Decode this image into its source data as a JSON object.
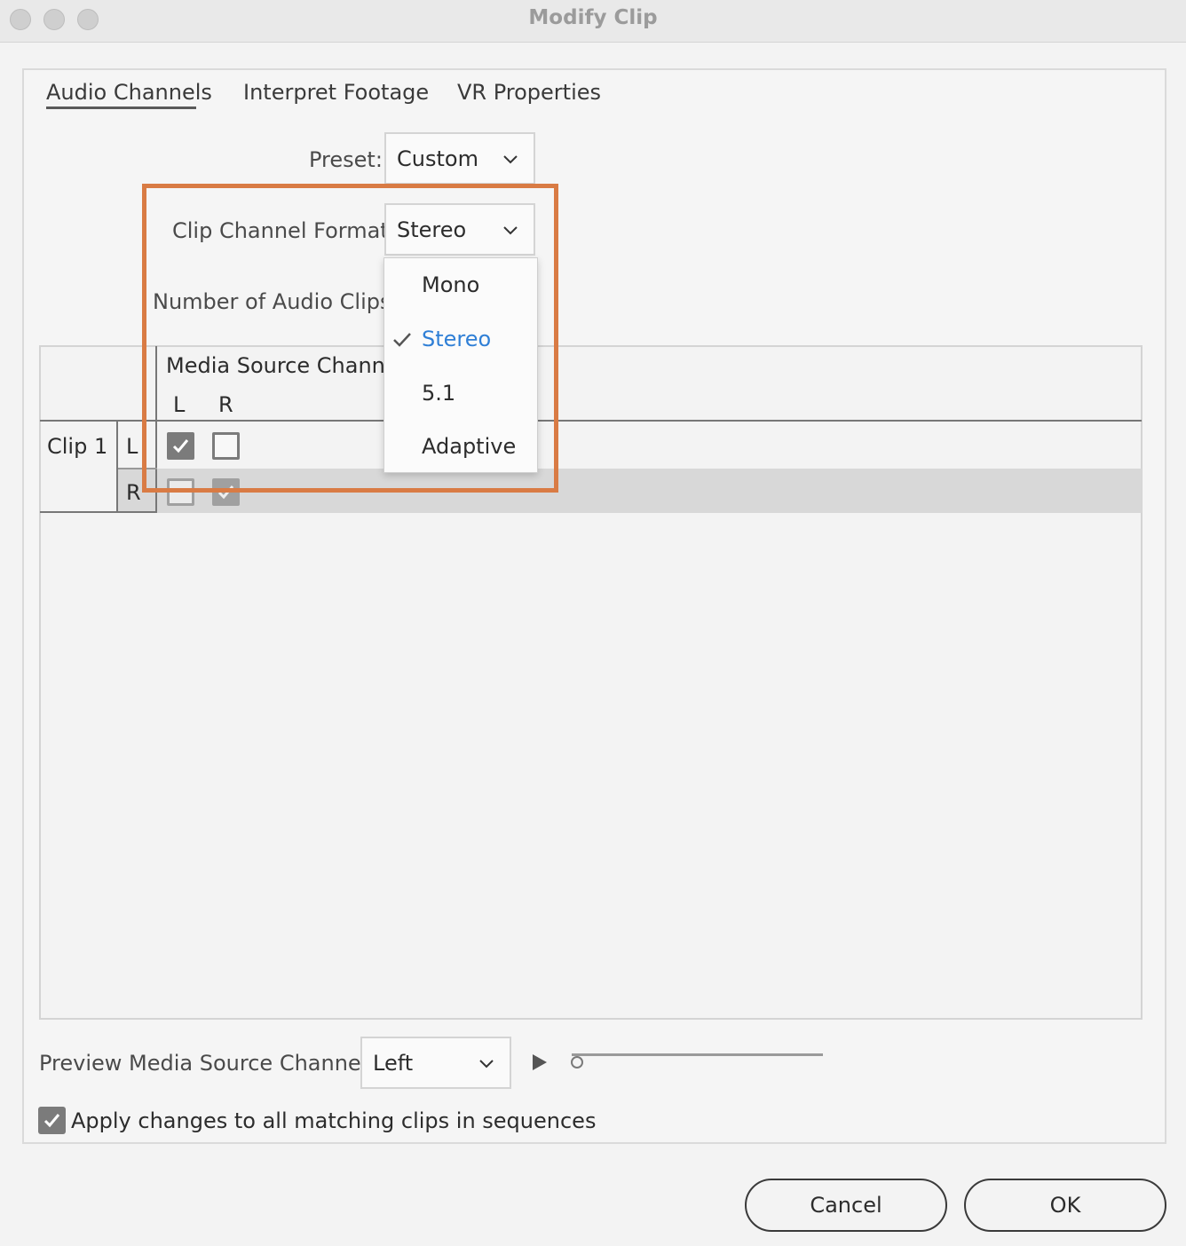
{
  "window": {
    "title": "Modify Clip"
  },
  "tabs": [
    {
      "label": "Audio Channels",
      "active": true
    },
    {
      "label": "Interpret Footage"
    },
    {
      "label": "VR Properties"
    }
  ],
  "preset": {
    "label": "Preset:",
    "value": "Custom"
  },
  "clip_channel_format": {
    "label": "Clip Channel Format:",
    "value": "Stereo",
    "options": [
      "Mono",
      "Stereo",
      "5.1",
      "Adaptive"
    ],
    "selected": "Stereo"
  },
  "number_of_audio_clips": {
    "label": "Number of Audio Clips:"
  },
  "table": {
    "header": "Media Source Channel:",
    "columns": [
      "L",
      "R"
    ],
    "clip_label": "Clip 1",
    "rows": [
      {
        "channel": "L",
        "checks": [
          true,
          false
        ]
      },
      {
        "channel": "R",
        "checks": [
          false,
          true
        ]
      }
    ]
  },
  "preview": {
    "label": "Preview Media Source Channel:",
    "value": "Left"
  },
  "apply_all": {
    "label": "Apply changes to all matching clips in sequences",
    "checked": true
  },
  "buttons": {
    "cancel": "Cancel",
    "ok": "OK"
  },
  "colors": {
    "highlight": "#d97b44",
    "selected_item": "#2f7fd6"
  },
  "icons": {
    "play": "play-icon",
    "chevron": "chevron-down-icon",
    "check": "checkmark-icon"
  }
}
